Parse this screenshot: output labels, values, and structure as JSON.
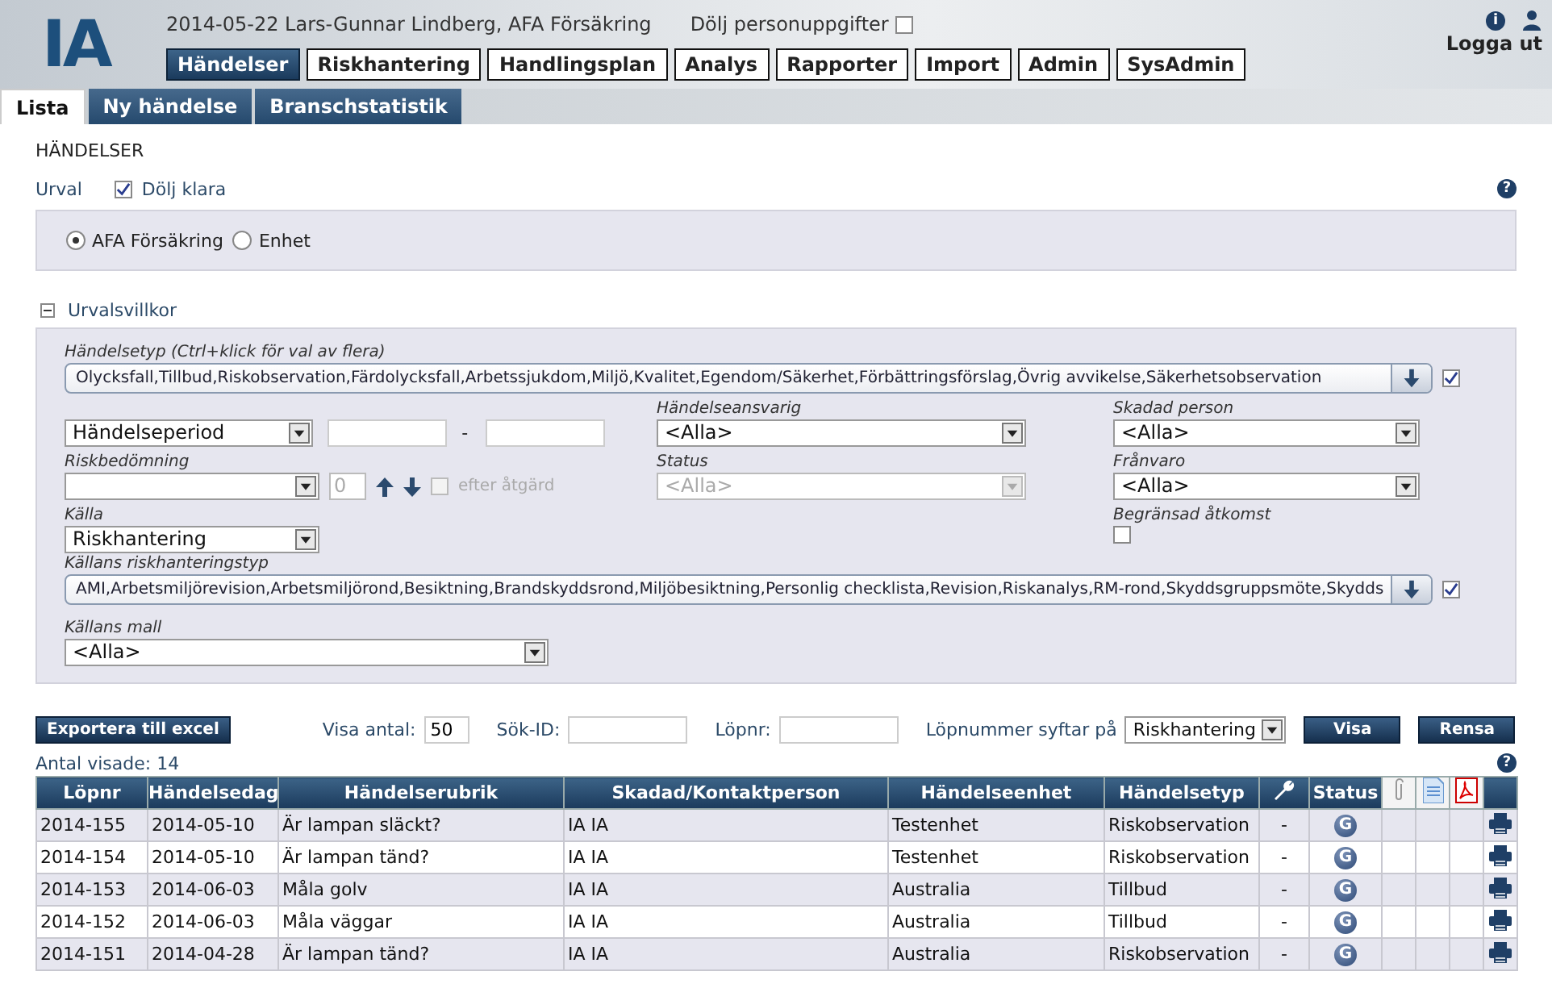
{
  "header": {
    "logo": "IA",
    "user_line": "2014-05-22 Lars-Gunnar Lindberg, AFA Försäkring",
    "hide_personal": {
      "label": "Dölj personuppgifter",
      "checked": false
    },
    "info": "i",
    "logout": "Logga ut",
    "nav": [
      {
        "label": "Händelser",
        "selected": true
      },
      {
        "label": "Riskhantering",
        "selected": false
      },
      {
        "label": "Handlingsplan",
        "selected": false
      },
      {
        "label": "Analys",
        "selected": false
      },
      {
        "label": "Rapporter",
        "selected": false
      },
      {
        "label": "Import",
        "selected": false
      },
      {
        "label": "Admin",
        "selected": false
      },
      {
        "label": "SysAdmin",
        "selected": false
      }
    ]
  },
  "tabs": [
    {
      "label": "Lista",
      "selected": true
    },
    {
      "label": "Ny händelse",
      "selected": false
    },
    {
      "label": "Branschstatistik",
      "selected": false
    }
  ],
  "page_title": "HÄNDELSER",
  "selection": {
    "label": "Urval",
    "hide_done": {
      "label": "Dölj klara",
      "checked": true
    },
    "help": "?",
    "scope": [
      {
        "label": "AFA Försäkring",
        "selected": true
      },
      {
        "label": "Enhet",
        "selected": false
      }
    ]
  },
  "criteria": {
    "title": "Urvalsvillkor",
    "expanded": true,
    "event_type": {
      "label": "Händelsetyp (Ctrl+klick för val av flera)",
      "value": "Olycksfall,Tillbud,Riskobservation,Färdolycksfall,Arbetssjukdom,Miljö,Kvalitet,Egendom/Säkerhet,Förbättringsförslag,Övrig avvikelse,Säkerhetsobservation",
      "all_checked": true
    },
    "period": {
      "value": "Händelseperiod",
      "separator": "-"
    },
    "risk": {
      "label": "Riskbedömning",
      "count": "0",
      "after_action": {
        "label": "efter åtgärd",
        "checked": false,
        "disabled": true
      }
    },
    "source": {
      "label": "Källa",
      "value": "Riskhantering"
    },
    "responsible": {
      "label": "Händelseansvarig",
      "value": "<Alla>"
    },
    "status": {
      "label": "Status",
      "value": "<Alla>",
      "disabled": true
    },
    "injured": {
      "label": "Skadad person",
      "value": "<Alla>"
    },
    "absence": {
      "label": "Frånvaro",
      "value": "<Alla>"
    },
    "restricted": {
      "label": "Begränsad åtkomst",
      "checked": false
    },
    "source_type": {
      "label": "Källans riskhanteringstyp",
      "value": "AMI,Arbetsmiljörevision,Arbetsmiljörond,Besiktning,Brandskyddsrond,Miljöbesiktning,Personlig checklista,Revision,Riskanalys,RM-rond,Skyddsgruppsmöte,Skydds",
      "all_checked": true
    },
    "template": {
      "label": "Källans mall",
      "value": "<Alla>"
    }
  },
  "toolbar": {
    "export": "Exportera till excel",
    "show_count": {
      "label": "Visa antal:",
      "value": "50"
    },
    "search_id": {
      "label": "Sök-ID:"
    },
    "number": {
      "label": "Löpnr:"
    },
    "refers": {
      "label": "Löpnummer syftar på",
      "value": "Riskhantering"
    },
    "show": "Visa",
    "clear": "Rensa"
  },
  "count": "Antal visade: 14",
  "help": "?",
  "table": {
    "columns": [
      {
        "kind": "text",
        "label": "Löpnr"
      },
      {
        "kind": "text",
        "label": "Händelsedag"
      },
      {
        "kind": "text",
        "label": "Händelserubrik"
      },
      {
        "kind": "text",
        "label": "Skadad/Kontaktperson"
      },
      {
        "kind": "text",
        "label": "Händelseenhet"
      },
      {
        "kind": "text",
        "label": "Händelsetyp"
      },
      {
        "kind": "wrench"
      },
      {
        "kind": "text",
        "label": "Status"
      },
      {
        "kind": "clip"
      },
      {
        "kind": "document"
      },
      {
        "kind": "pdf"
      },
      {
        "kind": "blank"
      }
    ],
    "rows": [
      {
        "cells": [
          "2014-155",
          "2014-05-10",
          "Är lampan släckt?",
          "IA IA",
          "Testenhet",
          "Riskobservation",
          "-"
        ],
        "status": "G"
      },
      {
        "cells": [
          "2014-154",
          "2014-05-10",
          "Är lampan tänd?",
          "IA IA",
          "Testenhet",
          "Riskobservation",
          "-"
        ],
        "status": "G"
      },
      {
        "cells": [
          "2014-153",
          "2014-06-03",
          "Måla golv",
          "IA IA",
          "Australia",
          "Tillbud",
          "-"
        ],
        "status": "G"
      },
      {
        "cells": [
          "2014-152",
          "2014-06-03",
          "Måla väggar",
          "IA IA",
          "Australia",
          "Tillbud",
          "-"
        ],
        "status": "G"
      },
      {
        "cells": [
          "2014-151",
          "2014-04-28",
          "Är lampan tänd?",
          "IA IA",
          "Australia",
          "Riskobservation",
          "-"
        ],
        "status": "G"
      }
    ]
  }
}
